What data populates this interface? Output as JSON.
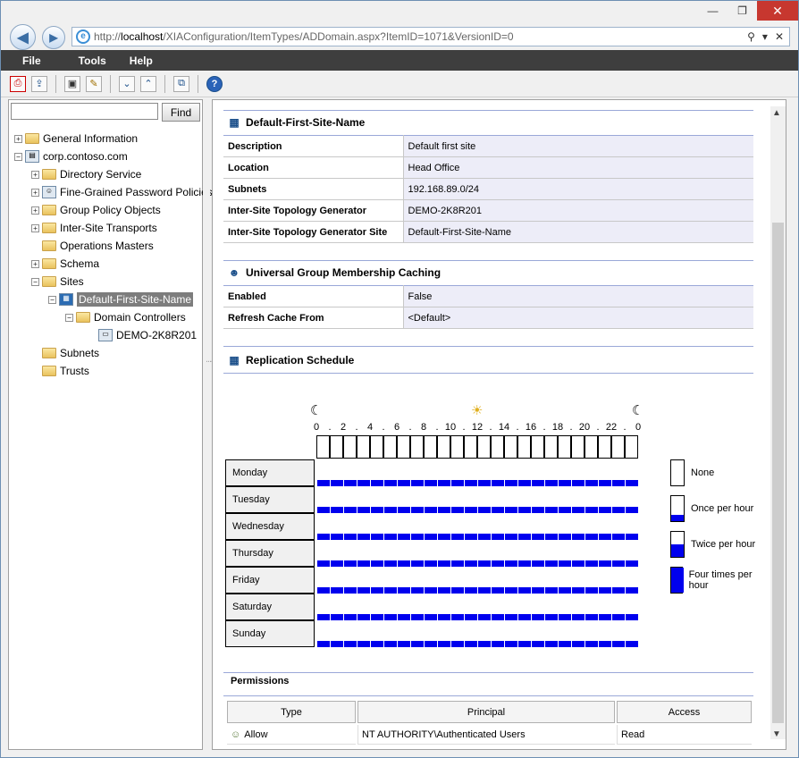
{
  "window": {
    "minimize": "—",
    "restore": "❐",
    "close": "✕"
  },
  "browser": {
    "url_prefix": "http://",
    "url_host": "localhost",
    "url_path": "/XIAConfiguration/ItemTypes/ADDomain.aspx?ItemID=1071&VersionID=0",
    "back_icon": "arrow-left",
    "forward_icon": "arrow-right"
  },
  "menu": {
    "file": "File",
    "tools": "Tools",
    "help": "Help"
  },
  "search": {
    "placeholder": "",
    "find_label": "Find"
  },
  "tree": [
    {
      "label": "General Information"
    },
    {
      "label": "corp.contoso.com"
    },
    {
      "label": "Directory Service"
    },
    {
      "label": "Fine-Grained Password Policies"
    },
    {
      "label": "Group Policy Objects"
    },
    {
      "label": "Inter-Site Transports"
    },
    {
      "label": "Operations Masters"
    },
    {
      "label": "Schema"
    },
    {
      "label": "Sites"
    },
    {
      "label": "Default-First-Site-Name"
    },
    {
      "label": "Domain Controllers"
    },
    {
      "label": "DEMO-2K8R201"
    },
    {
      "label": "Subnets"
    },
    {
      "label": "Trusts"
    }
  ],
  "site": {
    "title": "Default-First-Site-Name",
    "rows": [
      {
        "k": "Description",
        "v": "Default first site"
      },
      {
        "k": "Location",
        "v": "Head Office"
      },
      {
        "k": "Subnets",
        "v": "192.168.89.0/24"
      },
      {
        "k": "Inter-Site Topology Generator",
        "v": "DEMO-2K8R201"
      },
      {
        "k": "Inter-Site Topology Generator Site",
        "v": "Default-First-Site-Name"
      }
    ]
  },
  "ugmc": {
    "title": "Universal Group Membership Caching",
    "rows": [
      {
        "k": "Enabled",
        "v": "False"
      },
      {
        "k": "Refresh Cache From",
        "v": "<Default>"
      }
    ]
  },
  "schedule": {
    "title": "Replication Schedule",
    "hour_labels": [
      "0",
      ".",
      "2",
      ".",
      "4",
      ".",
      "6",
      ".",
      "8",
      ".",
      "10",
      ".",
      "12",
      ".",
      "14",
      ".",
      "16",
      ".",
      "18",
      ".",
      "20",
      ".",
      "22",
      ".",
      "0"
    ],
    "days": [
      "Monday",
      "Tuesday",
      "Wednesday",
      "Thursday",
      "Friday",
      "Saturday",
      "Sunday"
    ],
    "level_per_cell": "once-per-hour",
    "legend": [
      {
        "label": "None",
        "fill": 0
      },
      {
        "label": "Once per hour",
        "fill": 0.25
      },
      {
        "label": "Twice per hour",
        "fill": 0.5
      },
      {
        "label": "Four times per hour",
        "fill": 1.0
      }
    ],
    "fill_color": "#0000ee"
  },
  "permissions": {
    "title": "Permissions",
    "columns": [
      "Type",
      "Principal",
      "Access"
    ],
    "rows": [
      {
        "type": "Allow",
        "principal": "NT AUTHORITY\\Authenticated Users",
        "access": "Read"
      }
    ]
  }
}
